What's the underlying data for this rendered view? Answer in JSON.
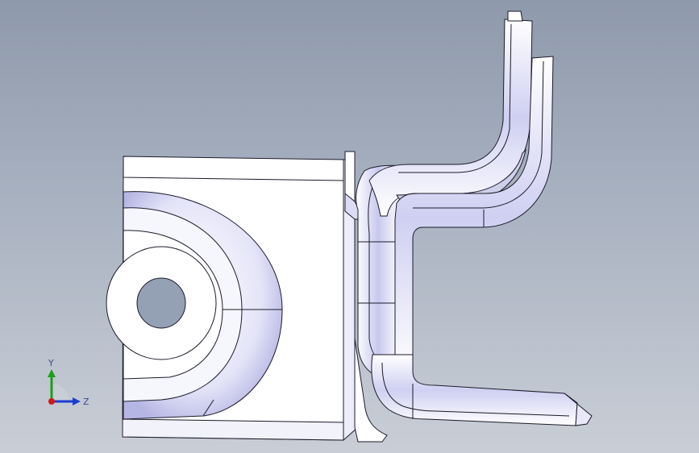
{
  "window": {
    "background_top": "#8e99ab",
    "background_bottom": "#c9ced6"
  },
  "model": {
    "body_fill": "#ffffff",
    "edge_color": "#1b1b2a",
    "shade_color": "#b9b9e6"
  },
  "triad": {
    "y_label": "Y",
    "z_label": "Z",
    "y_color": "#1aa01a",
    "z_color": "#1a3ed0",
    "x_color": "#d01a1a",
    "icon": "coordinate-triad-icon"
  }
}
